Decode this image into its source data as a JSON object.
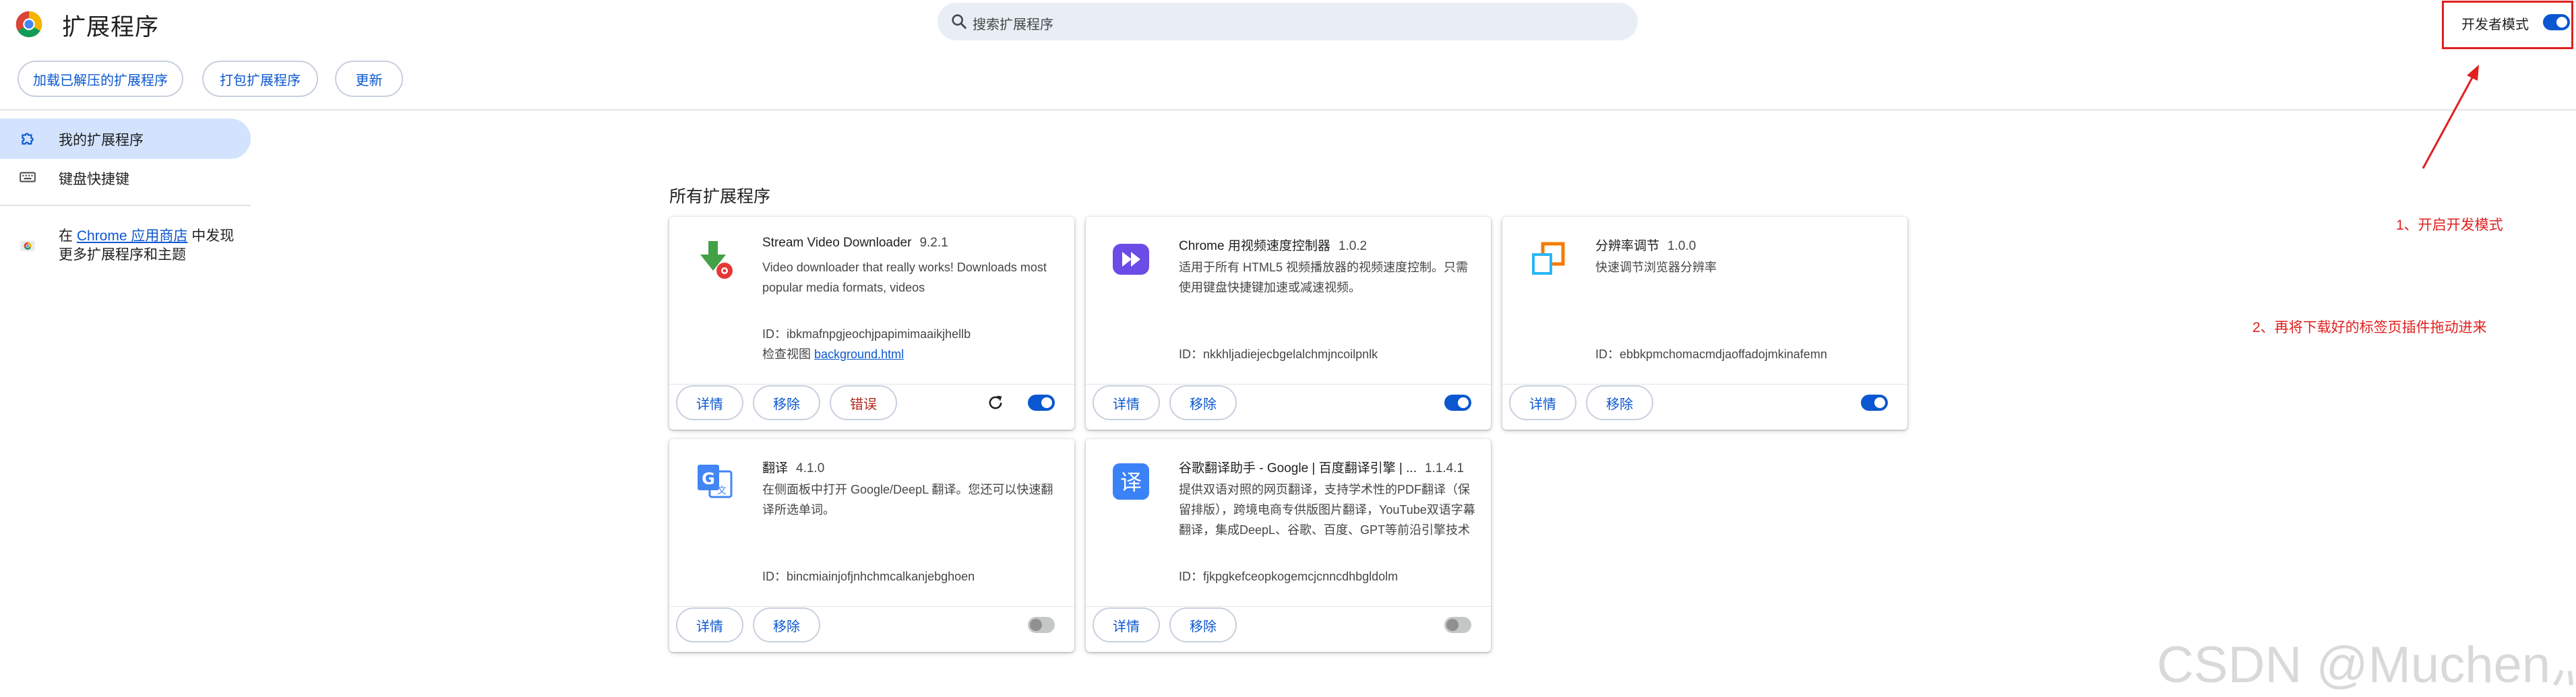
{
  "header": {
    "title": "扩展程序",
    "search_placeholder": "搜索扩展程序",
    "dev_mode_label": "开发者模式",
    "dev_mode_enabled": true
  },
  "toolbar": {
    "load_unpacked": "加载已解压的扩展程序",
    "pack": "打包扩展程序",
    "update": "更新"
  },
  "sidebar": {
    "items": [
      {
        "label": "我的扩展程序",
        "icon": "extension-icon",
        "active": true
      },
      {
        "label": "键盘快捷键",
        "icon": "keyboard-icon",
        "active": false
      }
    ],
    "store_prefix": "在 ",
    "store_link": "Chrome 应用商店",
    "store_suffix": " 中发现",
    "store_line2": "更多扩展程序和主题"
  },
  "section_title": "所有扩展程序",
  "buttons": {
    "details": "详情",
    "remove": "移除",
    "errors": "错误"
  },
  "extensions": [
    {
      "name": "Stream Video Downloader",
      "version": "9.2.1",
      "description": "Video downloader that really works! Downloads most popular media formats, videos",
      "id_text": "ID：ibkmafnpgjeochjpapimimaaikjhellb",
      "inspect_label": "检查视图",
      "inspect_link": "background.html",
      "enabled": true,
      "icon": "download-arrow-icon"
    },
    {
      "name": "Chrome 用视频速度控制器",
      "version": "1.0.2",
      "description": "适用于所有 HTML5 视频播放器的视频速度控制。只需使用键盘快捷键加速或减速视频。",
      "id_text": "ID：nkkhljadiejecbgelalchmjncoilpnlk",
      "enabled": true,
      "icon": "fast-forward-icon"
    },
    {
      "name": "分辨率调节",
      "version": "1.0.0",
      "description": "快速调节浏览器分辨率",
      "id_text": "ID：ebbkpmchomacmdjaoffadojmkinafemn",
      "enabled": true,
      "icon": "resize-squares-icon"
    },
    {
      "name": "翻译",
      "version": "4.1.0",
      "description": "在侧面板中打开 Google/DeepL 翻译。您还可以快速翻译所选单词。",
      "id_text": "ID：bincmiainjofjnhchmcalkanjebghoen",
      "enabled": false,
      "icon": "google-translate-icon"
    },
    {
      "name": "谷歌翻译助手 - Google | 百度翻译引擎 | ...",
      "version": "1.1.4.1",
      "description": "提供双语对照的网页翻译，支持学术性的PDF翻译（保留排版），跨境电商专供版图片翻译，YouTube双语字幕翻译，集成DeepL、谷歌、百度、GPT等前沿引擎技术",
      "id_text": "ID：fjkpgkefceopkogemcjcnncdhbgldolm",
      "enabled": false,
      "icon": "translate-yi-icon"
    }
  ],
  "annotations": {
    "step1": "1、开启开发模式",
    "step2": "2、再将下载好的标签页插件拖动进来"
  },
  "watermark": "CSDN @Muchen灬",
  "colors": {
    "accent": "#0b57d0",
    "active_bg": "#d3e3fd",
    "annotation": "#e02020"
  }
}
